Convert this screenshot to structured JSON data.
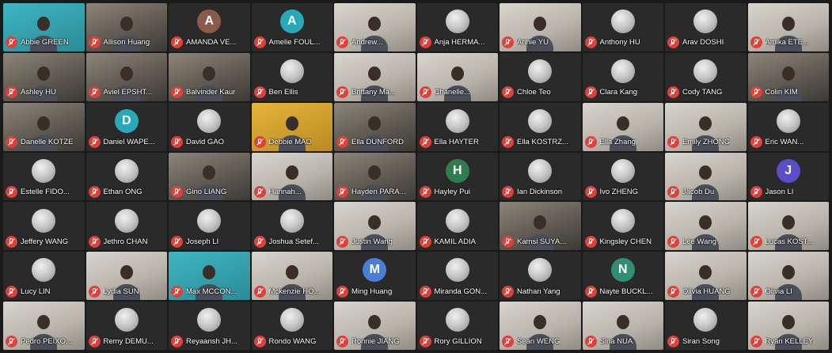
{
  "meeting": {
    "layout": "gallery",
    "participants": [
      {
        "name": "Abbie GREEN",
        "type": "video",
        "tone": "teal"
      },
      {
        "name": "Allison Huang",
        "type": "video",
        "tone": "video"
      },
      {
        "name": "AMANDA VE...",
        "type": "letter",
        "letter": "A",
        "color": "#8a5a4a"
      },
      {
        "name": "Amelie FOUL...",
        "type": "letter",
        "letter": "A",
        "color": "#28a9b8"
      },
      {
        "name": "Andrew...",
        "type": "video",
        "tone": "light"
      },
      {
        "name": "Anja HERMA...",
        "type": "photo"
      },
      {
        "name": "Annie YU",
        "type": "video",
        "tone": "light"
      },
      {
        "name": "Anthony HU",
        "type": "photo"
      },
      {
        "name": "Arav DOSHI",
        "type": "photo"
      },
      {
        "name": "Amika ETE...",
        "type": "video",
        "tone": "light"
      },
      {
        "name": "Ashley HU",
        "type": "video",
        "tone": "video"
      },
      {
        "name": "Aviel EPSHT...",
        "type": "video",
        "tone": "video"
      },
      {
        "name": "Balvinder Kaur",
        "type": "video",
        "tone": "video"
      },
      {
        "name": "Ben Ellis",
        "type": "photo"
      },
      {
        "name": "Brittany Ma...",
        "type": "video",
        "tone": "light"
      },
      {
        "name": "Chanelle...",
        "type": "video",
        "tone": "light"
      },
      {
        "name": "Chloe Teo",
        "type": "photo"
      },
      {
        "name": "Clara Kang",
        "type": "photo"
      },
      {
        "name": "Cody TANG",
        "type": "photo"
      },
      {
        "name": "Colin KIM",
        "type": "video",
        "tone": "video"
      },
      {
        "name": "Danelle KOTZE",
        "type": "video",
        "tone": "video"
      },
      {
        "name": "Daniel WAPE...",
        "type": "letter",
        "letter": "D",
        "color": "#28a9b8"
      },
      {
        "name": "David GAO",
        "type": "photo"
      },
      {
        "name": "Debbie MAO",
        "type": "video",
        "tone": "yellow"
      },
      {
        "name": "Ella DUNFORD",
        "type": "video",
        "tone": "video"
      },
      {
        "name": "Ella HAYTER",
        "type": "photo"
      },
      {
        "name": "Ella KOSTRZ...",
        "type": "photo"
      },
      {
        "name": "Ella Zhang",
        "type": "video",
        "tone": "light"
      },
      {
        "name": "Emily ZHONG",
        "type": "video",
        "tone": "light"
      },
      {
        "name": "Eric WAN...",
        "type": "photo"
      },
      {
        "name": "Estelle FIDO...",
        "type": "photo"
      },
      {
        "name": "Ethan ONG",
        "type": "photo"
      },
      {
        "name": "Gino LIANG",
        "type": "video",
        "tone": "video"
      },
      {
        "name": "Hannah...",
        "type": "video",
        "tone": "light"
      },
      {
        "name": "Hayden PARA...",
        "type": "video",
        "tone": "video"
      },
      {
        "name": "Hayley Pui",
        "type": "letter",
        "letter": "H",
        "color": "#2f7d4f"
      },
      {
        "name": "Ian Dickinson",
        "type": "photo"
      },
      {
        "name": "Ivo ZHENG",
        "type": "photo"
      },
      {
        "name": "Jacob Du",
        "type": "video",
        "tone": "light"
      },
      {
        "name": "Jason LI",
        "type": "letter",
        "letter": "J",
        "color": "#5a4fc8"
      },
      {
        "name": "Jeffery WANG",
        "type": "photo"
      },
      {
        "name": "Jethro CHAN",
        "type": "photo"
      },
      {
        "name": "Joseph LI",
        "type": "photo"
      },
      {
        "name": "Joshua Setef...",
        "type": "photo"
      },
      {
        "name": "Justin Wang",
        "type": "video",
        "tone": "light"
      },
      {
        "name": "KAMIL ADIA",
        "type": "photo"
      },
      {
        "name": "Kamsi SUYA...",
        "type": "video",
        "tone": "video"
      },
      {
        "name": "Kingsley CHEN",
        "type": "photo"
      },
      {
        "name": "Lee Wang",
        "type": "video",
        "tone": "light"
      },
      {
        "name": "Lucas KOST...",
        "type": "video",
        "tone": "light"
      },
      {
        "name": "Lucy LIN",
        "type": "photo"
      },
      {
        "name": "Lydia SUN",
        "type": "video",
        "tone": "light"
      },
      {
        "name": "Max MCCON...",
        "type": "video",
        "tone": "teal"
      },
      {
        "name": "Mckenzie HO...",
        "type": "video",
        "tone": "light"
      },
      {
        "name": "Ming Huang",
        "type": "letter",
        "letter": "M",
        "color": "#4a7fd8"
      },
      {
        "name": "Miranda GON...",
        "type": "photo"
      },
      {
        "name": "Nathan Yang",
        "type": "photo"
      },
      {
        "name": "Nayte BUCKL...",
        "type": "letter",
        "letter": "N",
        "color": "#2f8f74"
      },
      {
        "name": "Olivia HUANG",
        "type": "video",
        "tone": "light"
      },
      {
        "name": "Olivia LI",
        "type": "video",
        "tone": "light"
      },
      {
        "name": "Pedro PEIXO...",
        "type": "video",
        "tone": "light"
      },
      {
        "name": "Remy DEMU...",
        "type": "photo"
      },
      {
        "name": "Reyaansh JH...",
        "type": "photo"
      },
      {
        "name": "Rondo WANG",
        "type": "photo"
      },
      {
        "name": "Ronnie JIANG",
        "type": "video",
        "tone": "light"
      },
      {
        "name": "Rory GILLION",
        "type": "photo"
      },
      {
        "name": "Sean WENG",
        "type": "video",
        "tone": "light"
      },
      {
        "name": "Sina NUA",
        "type": "video",
        "tone": "light"
      },
      {
        "name": "Siran Song",
        "type": "photo"
      },
      {
        "name": "Ryan KELLEY",
        "type": "video",
        "tone": "light"
      }
    ]
  }
}
